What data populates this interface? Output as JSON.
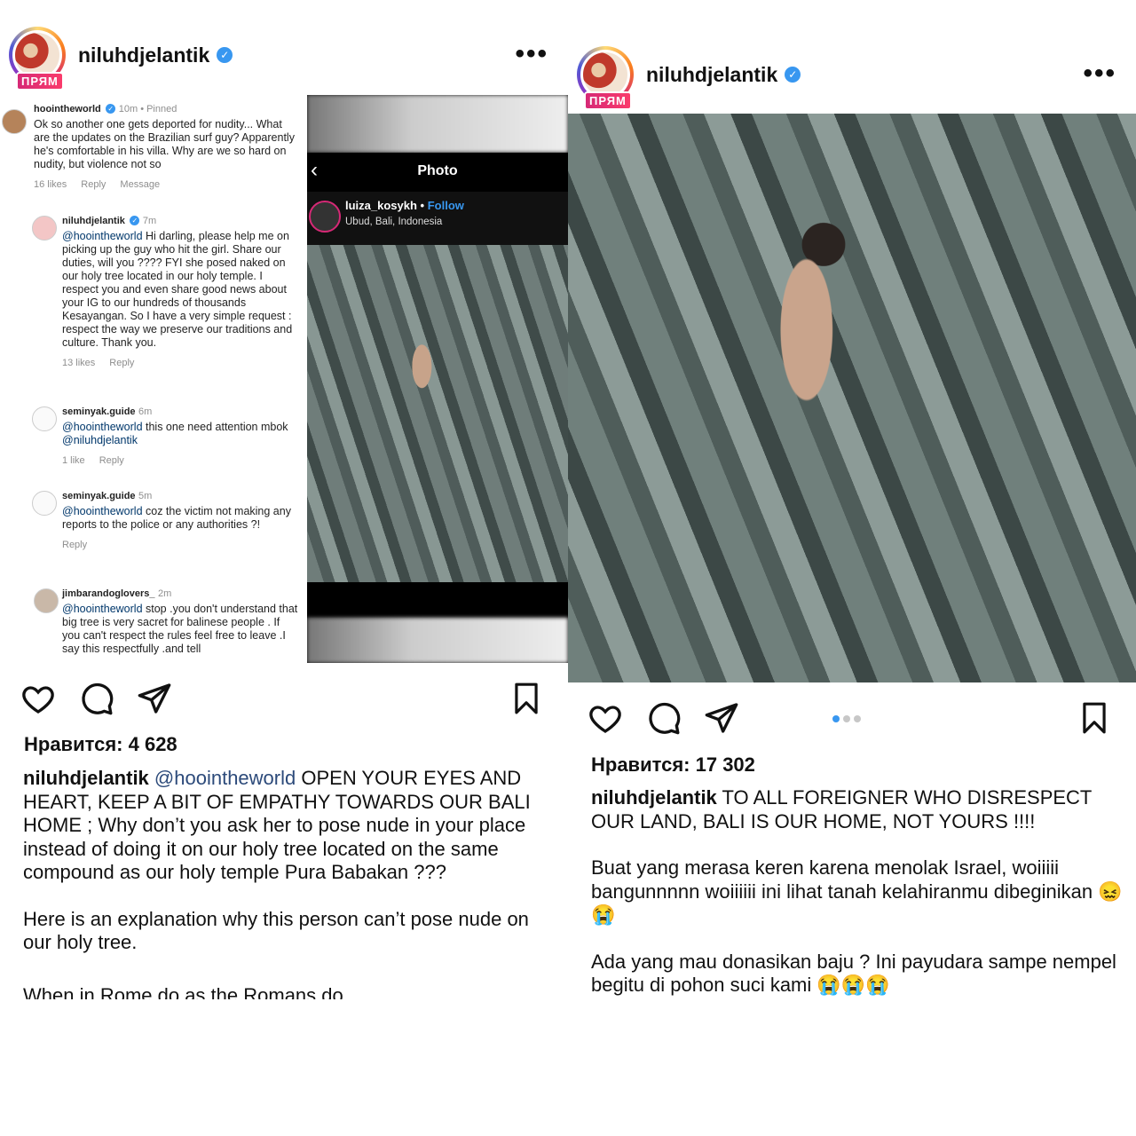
{
  "left_post": {
    "username": "niluhdjelantik",
    "live_badge": "ПРЯМ",
    "comments": [
      {
        "user": "hoointheworld",
        "time": "10m • Pinned",
        "text": "Ok so another one gets deported for nudity... What are the updates on the Brazilian surf guy? Apparently he's comfortable in his villa. Why are we so hard on nudity, but violence not so",
        "likes": "16 likes",
        "reply": "Reply",
        "message": "Message"
      },
      {
        "user": "niluhdjelantik",
        "time": "7m",
        "mention": "@hoointheworld",
        "text": " Hi darling, please help me on picking up the guy who hit the girl. Share our duties, will you ???? FYI she posed naked on our holy tree located in our holy temple. I respect you and even share good news about your IG to our hundreds of thousands Kesayangan. So I have a very simple request : respect the way we preserve our traditions and culture. Thank you.",
        "likes": "13 likes",
        "reply": "Reply"
      },
      {
        "user": "seminyak.guide",
        "time": "6m",
        "mention": "@hoointheworld",
        "text": " this one need attention mbok ",
        "mention2": "@niluhdjelantik",
        "likes": "1 like",
        "reply": "Reply"
      },
      {
        "user": "seminyak.guide",
        "time": "5m",
        "mention": "@hoointheworld",
        "text": " coz the victim not making any reports to the police or any authorities ?!",
        "reply": "Reply"
      },
      {
        "user": "jimbarandoglovers_",
        "time": "2m",
        "mention": "@hoointheworld",
        "text": " stop .you don't understand that big tree is very sacret for balinese people . If you can't respect the rules feel free to leave .I say this respectfully .and tell"
      }
    ],
    "screenshot": {
      "title": "Photo",
      "user": "luiza_kosykh",
      "follow": "Follow",
      "location": "Ubud, Bali, Indonesia"
    },
    "likes": "Нравится: 4 628",
    "caption_user": "niluhdjelantik",
    "caption_mention": "@hoointheworld",
    "caption_p1": " OPEN YOUR EYES AND HEART, KEEP A BIT OF EMPATHY TOWARDS OUR BALI HOME ; Why don’t you ask her to pose nude in your place instead of doing it on our holy tree located on the same compound as our holy temple Pura Babakan ???",
    "caption_p2": "Here is an explanation why this person can’t pose nude on our holy tree.",
    "caption_p3": "When in Rome do as the Romans do"
  },
  "right_post": {
    "username": "niluhdjelantik",
    "live_badge": "ПРЯМ",
    "likes": "Нравится: 17 302",
    "caption_user": "niluhdjelantik",
    "caption_p1": " TO ALL FOREIGNER WHO DISRESPECT OUR LAND, BALI IS OUR HOME, NOT YOURS !!!!",
    "caption_p2": "Buat yang merasa keren karena menolak Israel, woiiiii bangunnnnn woiiiiii ini lihat tanah kelahiranmu dibeginikan 😖😭",
    "caption_p3": "Ada yang mau donasikan baju ? Ini payudara sampe nempel begitu di pohon suci kami 😭😭😭"
  },
  "icons": [
    "heart-icon",
    "comment-icon",
    "share-icon",
    "bookmark-icon",
    "more-icon",
    "verified-icon",
    "back-icon"
  ],
  "colors": {
    "verified": "#3897f0",
    "mention": "#00376b",
    "accent": "#d62976"
  }
}
